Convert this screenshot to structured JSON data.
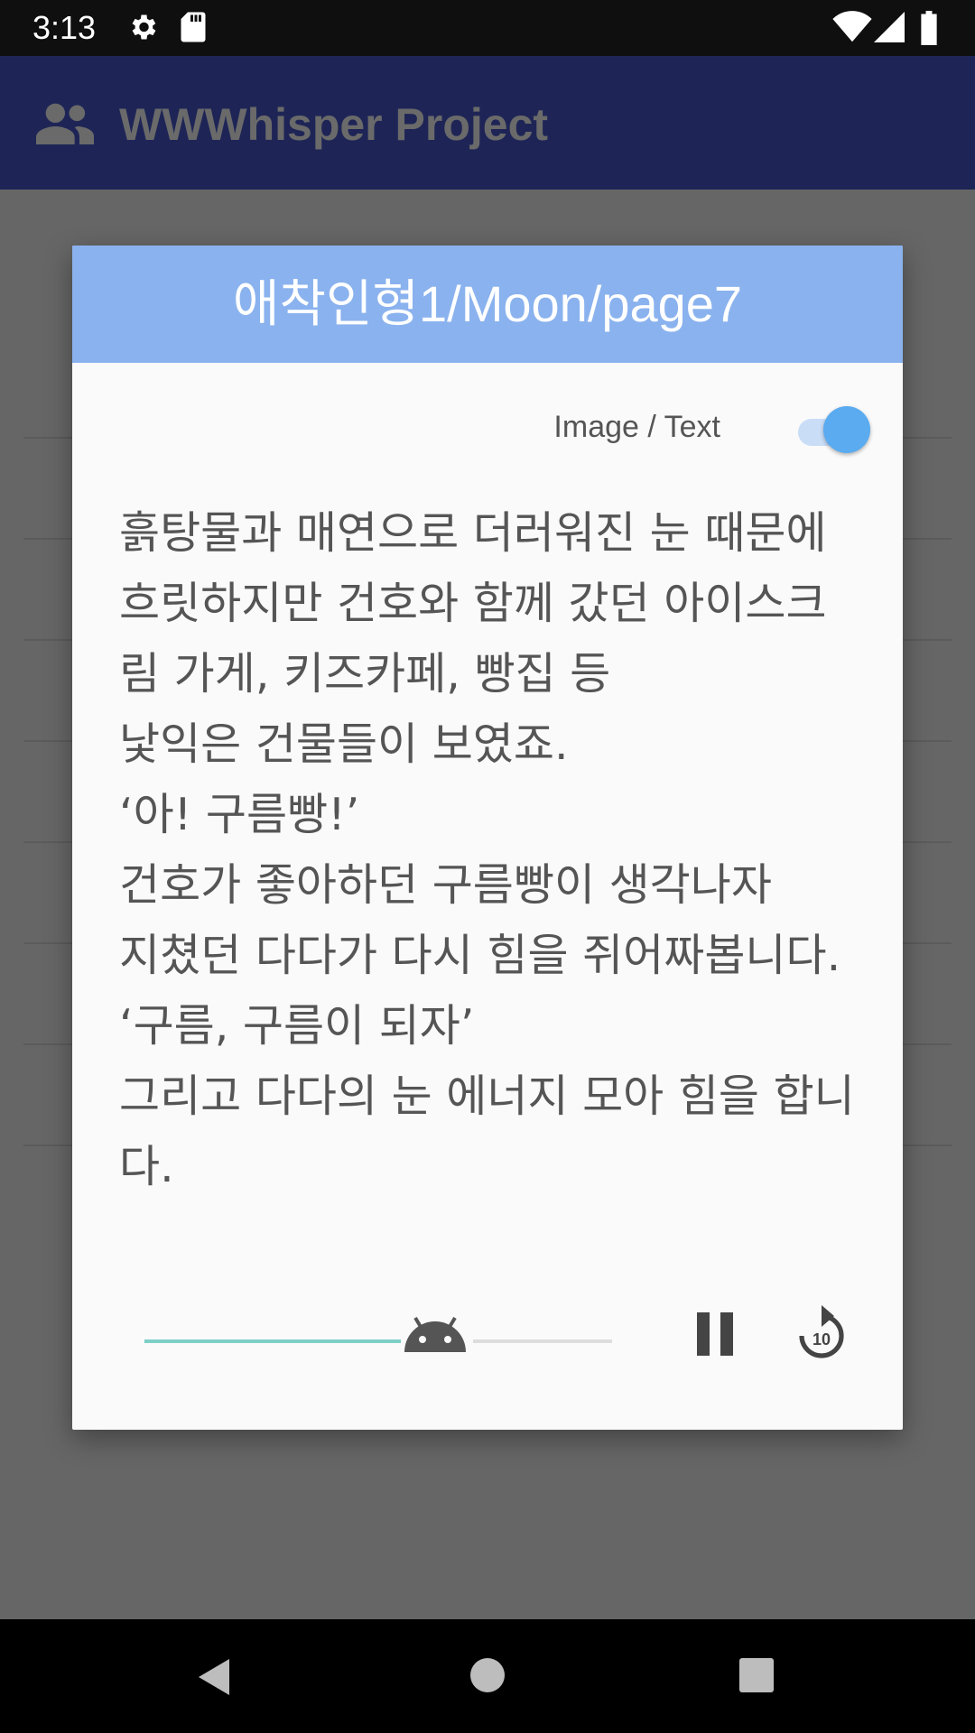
{
  "status_bar": {
    "time": "3:13",
    "icons": [
      "gear-icon",
      "sd-card-icon",
      "wifi-icon",
      "signal-icon",
      "battery-icon"
    ]
  },
  "app_bar": {
    "title": "WWWhisper Project",
    "icon": "people-icon"
  },
  "dialog": {
    "title": "애착인형1/Moon/page7",
    "toggle_label": "Image / Text",
    "toggle_on": true,
    "story_text": "흙탕물과 매연으로 더러워진 눈 때문에\n흐릿하지만 건호와 함께 갔던 아이스크림 가게, 키즈카페, 빵집 등\n낯익은 건물들이 보였죠.\n‘아! 구름빵!’\n건호가 좋아하던 구름빵이 생각나자\n지쳤던 다다가 다시 힘을 쥐어짜봅니다.\n‘구름, 구름이 되자’\n그리고 다다의 눈 에너지 모아 힘을 합니다."
  },
  "player": {
    "progress": 0.7,
    "pause_icon": "pause-icon",
    "replay_icon": "replay-10-icon",
    "replay_seconds": "10",
    "thumb_icon": "android-icon"
  },
  "colors": {
    "header": "#8ab2ee",
    "app_bar": "#1e2556",
    "toggle_thumb": "#5aabf0",
    "seek_progress": "#7ecfc8"
  }
}
